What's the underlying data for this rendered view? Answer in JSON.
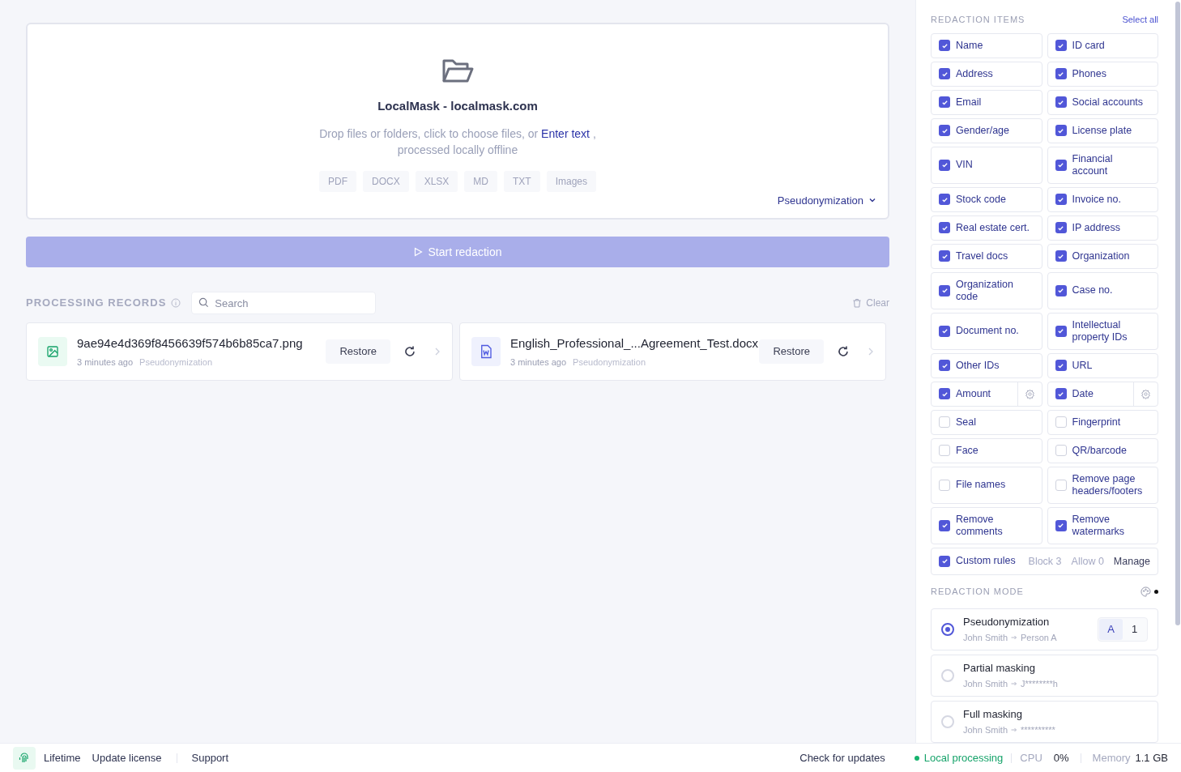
{
  "drop_zone": {
    "title": "LocalMask - localmask.com",
    "hint_before": "Drop files or folders, click to choose files, or",
    "hint_link": "Enter text",
    "hint_after": ", processed locally offline",
    "formats": [
      "PDF",
      "DOCX",
      "XLSX",
      "MD",
      "TXT",
      "Images"
    ],
    "mode_select": "Pseudonymization"
  },
  "start_button": {
    "label": "Start redaction",
    "disabled": true
  },
  "records": {
    "title": "PROCESSING RECORDS",
    "search": {
      "placeholder": "Search"
    },
    "clear": "Clear",
    "items": [
      {
        "kind": "image",
        "name": "9ae94e4d369f8456639f574b6b85ca7.png",
        "time": "3 minutes ago",
        "mode": "Pseudonymization",
        "restore": "Restore"
      },
      {
        "kind": "word",
        "name": "English_Professional_...Agreement_Test.docx",
        "time": "3 minutes ago",
        "mode": "Pseudonymization",
        "restore": "Restore"
      }
    ]
  },
  "redaction_items": {
    "title": "REDACTION ITEMS",
    "select_all": "Select all",
    "items": [
      {
        "kind": "plain",
        "label": "Name",
        "checked": true
      },
      {
        "kind": "plain",
        "label": "ID card",
        "checked": true
      },
      {
        "kind": "plain",
        "label": "Address",
        "checked": true
      },
      {
        "kind": "plain",
        "label": "Phones",
        "checked": true
      },
      {
        "kind": "plain",
        "label": "Email",
        "checked": true
      },
      {
        "kind": "plain",
        "label": "Social accounts",
        "checked": true
      },
      {
        "kind": "plain",
        "label": "Gender/age",
        "checked": true
      },
      {
        "kind": "plain",
        "label": "License plate",
        "checked": true
      },
      {
        "kind": "plain",
        "label": "VIN",
        "checked": true
      },
      {
        "kind": "plain",
        "label": "Financial account",
        "checked": true
      },
      {
        "kind": "plain",
        "label": "Stock code",
        "checked": true
      },
      {
        "kind": "plain",
        "label": "Invoice no.",
        "checked": true
      },
      {
        "kind": "plain",
        "label": "Real estate cert.",
        "checked": true
      },
      {
        "kind": "plain",
        "label": "IP address",
        "checked": true
      },
      {
        "kind": "plain",
        "label": "Travel docs",
        "checked": true
      },
      {
        "kind": "plain",
        "label": "Organization",
        "checked": true
      },
      {
        "kind": "plain",
        "label": "Organization code",
        "checked": true
      },
      {
        "kind": "plain",
        "label": "Case no.",
        "checked": true
      },
      {
        "kind": "plain",
        "label": "Document no.",
        "checked": true
      },
      {
        "kind": "plain",
        "label": "Intellectual property IDs",
        "checked": true
      },
      {
        "kind": "plain",
        "label": "Other IDs",
        "checked": true
      },
      {
        "kind": "plain",
        "label": "URL",
        "checked": true
      },
      {
        "kind": "settings",
        "label": "Amount",
        "checked": true
      },
      {
        "kind": "settings",
        "label": "Date",
        "checked": true
      },
      {
        "kind": "plain",
        "label": "Seal",
        "checked": false
      },
      {
        "kind": "plain",
        "label": "Fingerprint",
        "checked": false
      },
      {
        "kind": "plain",
        "label": "Face",
        "checked": false
      },
      {
        "kind": "plain",
        "label": "QR/barcode",
        "checked": false
      },
      {
        "kind": "plain",
        "label": "File names",
        "checked": false
      },
      {
        "kind": "plain",
        "label": "Remove page headers/footers",
        "checked": false
      },
      {
        "kind": "plain",
        "label": "Remove comments",
        "checked": true
      },
      {
        "kind": "plain",
        "label": "Remove watermarks",
        "checked": true
      },
      {
        "kind": "custom",
        "label": "Custom rules",
        "checked": true,
        "block": "Block 3",
        "allow": "Allow 0",
        "manage": "Manage"
      }
    ]
  },
  "redaction_mode": {
    "title": "REDACTION MODE",
    "modes": [
      {
        "name": "Pseudonymization",
        "from": "John Smith",
        "to": "Person A",
        "selected": true,
        "options": [
          {
            "label": "A",
            "selected": true
          },
          {
            "label": "1",
            "selected": false
          }
        ]
      },
      {
        "name": "Partial masking",
        "from": "John Smith",
        "to": "J********h",
        "selected": false
      },
      {
        "name": "Full masking",
        "from": "John Smith",
        "to": "**********",
        "selected": false
      }
    ]
  },
  "status_bar": {
    "plan": "Lifetime",
    "update_license": "Update license",
    "support": "Support",
    "check_updates": "Check for updates",
    "local": "Local processing",
    "cpu_label": "CPU",
    "cpu": "0%",
    "memory_label": "Memory",
    "memory": "1.1 GB"
  }
}
